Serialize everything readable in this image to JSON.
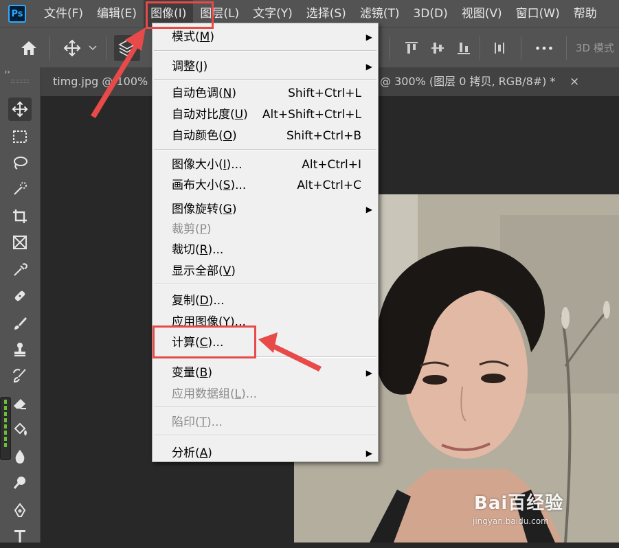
{
  "app": {
    "logo": "Ps"
  },
  "menubar": {
    "items": [
      {
        "label": "文件(F)"
      },
      {
        "label": "编辑(E)"
      },
      {
        "label": "图像(I)"
      },
      {
        "label": "图层(L)"
      },
      {
        "label": "文字(Y)"
      },
      {
        "label": "选择(S)"
      },
      {
        "label": "滤镜(T)"
      },
      {
        "label": "3D(D)"
      },
      {
        "label": "视图(V)"
      },
      {
        "label": "窗口(W)"
      },
      {
        "label": "帮助"
      }
    ]
  },
  "optionsbar": {
    "more_label": "•••",
    "mode_label": "3D 模式"
  },
  "toolbar": {
    "collapse": "››",
    "tools": [
      "move-tool",
      "marquee-tool",
      "lasso-tool",
      "quick-selection-tool",
      "crop-tool",
      "frame-tool",
      "eyedropper-tool",
      "healing-brush-tool",
      "brush-tool",
      "clone-stamp-tool",
      "history-brush-tool",
      "eraser-tool",
      "paint-bucket-tool",
      "blur-tool",
      "dodge-tool",
      "pen-tool",
      "type-tool"
    ]
  },
  "tabs": {
    "tab1": "timg.jpg @ 100%",
    "tab2": "@ 300% (图层 0 拷贝, RGB/8#) *",
    "close": "×"
  },
  "image_menu": {
    "items": [
      {
        "label": "模式(",
        "key": "M",
        "tail": ")",
        "shortcut": "",
        "submenu": true,
        "disabled": false
      },
      {
        "label": "调整(",
        "key": "J",
        "tail": ")",
        "shortcut": "",
        "submenu": true,
        "disabled": false
      },
      {
        "label": "自动色调(",
        "key": "N",
        "tail": ")",
        "shortcut": "Shift+Ctrl+L",
        "submenu": false,
        "disabled": false
      },
      {
        "label": "自动对比度(",
        "key": "U",
        "tail": ")",
        "shortcut": "Alt+Shift+Ctrl+L",
        "submenu": false,
        "disabled": false
      },
      {
        "label": "自动颜色(",
        "key": "O",
        "tail": ")",
        "shortcut": "Shift+Ctrl+B",
        "submenu": false,
        "disabled": false
      },
      {
        "label": "图像大小(",
        "key": "I",
        "tail": ")...",
        "shortcut": "Alt+Ctrl+I",
        "submenu": false,
        "disabled": false
      },
      {
        "label": "画布大小(",
        "key": "S",
        "tail": ")...",
        "shortcut": "Alt+Ctrl+C",
        "submenu": false,
        "disabled": false
      },
      {
        "label": "图像旋转(",
        "key": "G",
        "tail": ")",
        "shortcut": "",
        "submenu": true,
        "disabled": false
      },
      {
        "label": "裁剪(",
        "key": "P",
        "tail": ")",
        "shortcut": "",
        "submenu": false,
        "disabled": true
      },
      {
        "label": "裁切(",
        "key": "R",
        "tail": ")...",
        "shortcut": "",
        "submenu": false,
        "disabled": false
      },
      {
        "label": "显示全部(",
        "key": "V",
        "tail": ")",
        "shortcut": "",
        "submenu": false,
        "disabled": false
      },
      {
        "label": "复制(",
        "key": "D",
        "tail": ")...",
        "shortcut": "",
        "submenu": false,
        "disabled": false
      },
      {
        "label": "应用图像(",
        "key": "Y",
        "tail": ")...",
        "shortcut": "",
        "submenu": false,
        "disabled": false
      },
      {
        "label": "计算(",
        "key": "C",
        "tail": ")...",
        "shortcut": "",
        "submenu": false,
        "disabled": false
      },
      {
        "label": "变量(",
        "key": "B",
        "tail": ")",
        "shortcut": "",
        "submenu": true,
        "disabled": false
      },
      {
        "label": "应用数据组(",
        "key": "L",
        "tail": ")...",
        "shortcut": "",
        "submenu": false,
        "disabled": true
      },
      {
        "label": "陷印(",
        "key": "T",
        "tail": ")...",
        "shortcut": "",
        "submenu": false,
        "disabled": true
      },
      {
        "label": "分析(",
        "key": "A",
        "tail": ")",
        "shortcut": "",
        "submenu": true,
        "disabled": false
      }
    ]
  },
  "watermark": {
    "text": "Bai百经验",
    "url": "jingyan.baidu.com"
  },
  "colors": {
    "highlight": "#e84a4a",
    "accent": "#31a8ff"
  }
}
